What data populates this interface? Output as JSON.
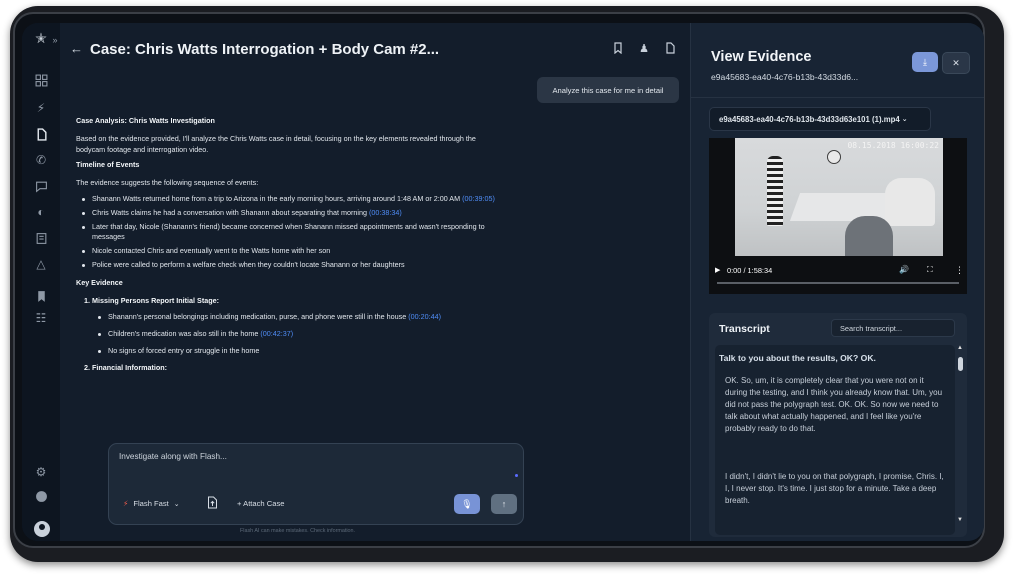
{
  "header": {
    "title": "Case: Chris Watts Interrogation + Body Cam #2...",
    "actions": [
      "bookmark-icon",
      "users-icon",
      "document-icon",
      "more-icon"
    ]
  },
  "rail": [
    "grid-icon",
    "bolt-icon",
    "document-icon",
    "phone-icon",
    "chat-icon",
    "chart-icon",
    "building-icon",
    "bell-icon",
    "bookmark-icon",
    "people-icon",
    "settings-icon",
    "help-icon",
    "avatar-icon"
  ],
  "chat": {
    "user_message": "Analyze this case for me in detail",
    "heading": "Case Analysis: Chris Watts Investigation",
    "intro_line1": "Based on the evidence provided, I'll analyze the Chris Watts case in detail, focusing on the key elements revealed through the",
    "intro_line2": "bodycam footage and interrogation video.",
    "timeline_heading": "Timeline of Events",
    "timeline_intro": "The evidence suggests the following sequence of events:",
    "timeline": [
      {
        "text": "Shanann Watts returned home from a trip to Arizona in the early morning hours, arriving around 1:48 AM or 2:00 AM ",
        "ts": "(00:39:05)"
      },
      {
        "text": "Chris Watts claims he had a conversation with Shanann about separating that morning ",
        "ts": "(00:38:34)"
      },
      {
        "text": "Later that day, Nicole (Shanann's friend) became concerned when Shanann missed appointments and wasn't responding to",
        "ts": ""
      },
      {
        "text": "messages",
        "ts": ""
      },
      {
        "text": "Nicole contacted Chris and eventually went to the Watts home with her son",
        "ts": ""
      },
      {
        "text": "Police were called to perform a welfare check when they couldn't locate Shanann or her daughters",
        "ts": ""
      }
    ],
    "key_heading": "Key Evidence",
    "section1": "1. Missing Persons Report Initial Stage:",
    "section1_items": [
      {
        "text": "Shanann's personal belongings including medication, purse, and phone were still in the house ",
        "ts": "(00:20:44)"
      },
      {
        "text": "Children's medication was also still in the home ",
        "ts": "(00:42:37)"
      },
      {
        "text": "No signs of forced entry or struggle in the home",
        "ts": ""
      }
    ],
    "section2": "2. Financial Information:"
  },
  "composer": {
    "placeholder": "Investigate along with Flash...",
    "model": "Flash Fast",
    "attach": "+ Attach Case",
    "disclaimer": "Flash AI can make mistakes. Check information."
  },
  "panel": {
    "title": "View Evidence",
    "evidence_id": "e9a45683-ea40-4c76-b13b-43d33d6...",
    "file": "e9a45683-ea40-4c76-b13b-43d33d63e101 (1).mp4",
    "video_timestamp": "08.15.2018 16:00:22",
    "video_time": "0:00 / 1:58:34",
    "transcript_title": "Transcript",
    "search_placeholder": "Search transcript...",
    "transcript_heading": "Talk to you about the results, OK? OK.",
    "transcript_p1": "OK. So, um, it is completely clear that you were not on it during the testing, and I think you already know that. Um, you did not pass the polygraph test. OK. OK. So now we need to talk about what actually happened, and I feel like you're probably ready to do that.",
    "transcript_p2": "I didn't, I didn't lie to you on that polygraph, I promise, Chris. I, I, I never stop. It's time. I just stop for a minute. Take a deep breath."
  }
}
